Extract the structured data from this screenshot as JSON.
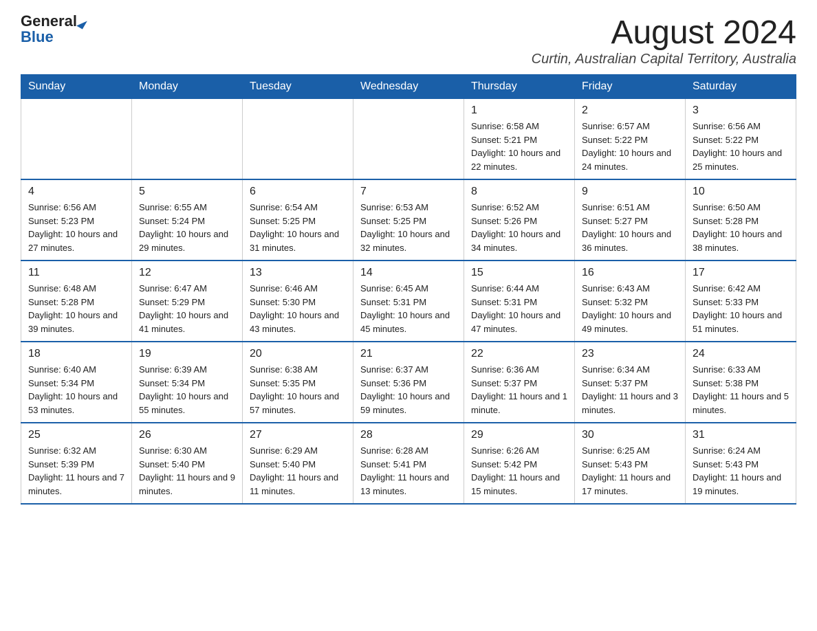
{
  "header": {
    "logo_general": "General",
    "logo_blue": "Blue",
    "month_title": "August 2024",
    "location": "Curtin, Australian Capital Territory, Australia"
  },
  "days_of_week": [
    "Sunday",
    "Monday",
    "Tuesday",
    "Wednesday",
    "Thursday",
    "Friday",
    "Saturday"
  ],
  "weeks": [
    [
      {
        "day": "",
        "info": ""
      },
      {
        "day": "",
        "info": ""
      },
      {
        "day": "",
        "info": ""
      },
      {
        "day": "",
        "info": ""
      },
      {
        "day": "1",
        "info": "Sunrise: 6:58 AM\nSunset: 5:21 PM\nDaylight: 10 hours and 22 minutes."
      },
      {
        "day": "2",
        "info": "Sunrise: 6:57 AM\nSunset: 5:22 PM\nDaylight: 10 hours and 24 minutes."
      },
      {
        "day": "3",
        "info": "Sunrise: 6:56 AM\nSunset: 5:22 PM\nDaylight: 10 hours and 25 minutes."
      }
    ],
    [
      {
        "day": "4",
        "info": "Sunrise: 6:56 AM\nSunset: 5:23 PM\nDaylight: 10 hours and 27 minutes."
      },
      {
        "day": "5",
        "info": "Sunrise: 6:55 AM\nSunset: 5:24 PM\nDaylight: 10 hours and 29 minutes."
      },
      {
        "day": "6",
        "info": "Sunrise: 6:54 AM\nSunset: 5:25 PM\nDaylight: 10 hours and 31 minutes."
      },
      {
        "day": "7",
        "info": "Sunrise: 6:53 AM\nSunset: 5:25 PM\nDaylight: 10 hours and 32 minutes."
      },
      {
        "day": "8",
        "info": "Sunrise: 6:52 AM\nSunset: 5:26 PM\nDaylight: 10 hours and 34 minutes."
      },
      {
        "day": "9",
        "info": "Sunrise: 6:51 AM\nSunset: 5:27 PM\nDaylight: 10 hours and 36 minutes."
      },
      {
        "day": "10",
        "info": "Sunrise: 6:50 AM\nSunset: 5:28 PM\nDaylight: 10 hours and 38 minutes."
      }
    ],
    [
      {
        "day": "11",
        "info": "Sunrise: 6:48 AM\nSunset: 5:28 PM\nDaylight: 10 hours and 39 minutes."
      },
      {
        "day": "12",
        "info": "Sunrise: 6:47 AM\nSunset: 5:29 PM\nDaylight: 10 hours and 41 minutes."
      },
      {
        "day": "13",
        "info": "Sunrise: 6:46 AM\nSunset: 5:30 PM\nDaylight: 10 hours and 43 minutes."
      },
      {
        "day": "14",
        "info": "Sunrise: 6:45 AM\nSunset: 5:31 PM\nDaylight: 10 hours and 45 minutes."
      },
      {
        "day": "15",
        "info": "Sunrise: 6:44 AM\nSunset: 5:31 PM\nDaylight: 10 hours and 47 minutes."
      },
      {
        "day": "16",
        "info": "Sunrise: 6:43 AM\nSunset: 5:32 PM\nDaylight: 10 hours and 49 minutes."
      },
      {
        "day": "17",
        "info": "Sunrise: 6:42 AM\nSunset: 5:33 PM\nDaylight: 10 hours and 51 minutes."
      }
    ],
    [
      {
        "day": "18",
        "info": "Sunrise: 6:40 AM\nSunset: 5:34 PM\nDaylight: 10 hours and 53 minutes."
      },
      {
        "day": "19",
        "info": "Sunrise: 6:39 AM\nSunset: 5:34 PM\nDaylight: 10 hours and 55 minutes."
      },
      {
        "day": "20",
        "info": "Sunrise: 6:38 AM\nSunset: 5:35 PM\nDaylight: 10 hours and 57 minutes."
      },
      {
        "day": "21",
        "info": "Sunrise: 6:37 AM\nSunset: 5:36 PM\nDaylight: 10 hours and 59 minutes."
      },
      {
        "day": "22",
        "info": "Sunrise: 6:36 AM\nSunset: 5:37 PM\nDaylight: 11 hours and 1 minute."
      },
      {
        "day": "23",
        "info": "Sunrise: 6:34 AM\nSunset: 5:37 PM\nDaylight: 11 hours and 3 minutes."
      },
      {
        "day": "24",
        "info": "Sunrise: 6:33 AM\nSunset: 5:38 PM\nDaylight: 11 hours and 5 minutes."
      }
    ],
    [
      {
        "day": "25",
        "info": "Sunrise: 6:32 AM\nSunset: 5:39 PM\nDaylight: 11 hours and 7 minutes."
      },
      {
        "day": "26",
        "info": "Sunrise: 6:30 AM\nSunset: 5:40 PM\nDaylight: 11 hours and 9 minutes."
      },
      {
        "day": "27",
        "info": "Sunrise: 6:29 AM\nSunset: 5:40 PM\nDaylight: 11 hours and 11 minutes."
      },
      {
        "day": "28",
        "info": "Sunrise: 6:28 AM\nSunset: 5:41 PM\nDaylight: 11 hours and 13 minutes."
      },
      {
        "day": "29",
        "info": "Sunrise: 6:26 AM\nSunset: 5:42 PM\nDaylight: 11 hours and 15 minutes."
      },
      {
        "day": "30",
        "info": "Sunrise: 6:25 AM\nSunset: 5:43 PM\nDaylight: 11 hours and 17 minutes."
      },
      {
        "day": "31",
        "info": "Sunrise: 6:24 AM\nSunset: 5:43 PM\nDaylight: 11 hours and 19 minutes."
      }
    ]
  ]
}
